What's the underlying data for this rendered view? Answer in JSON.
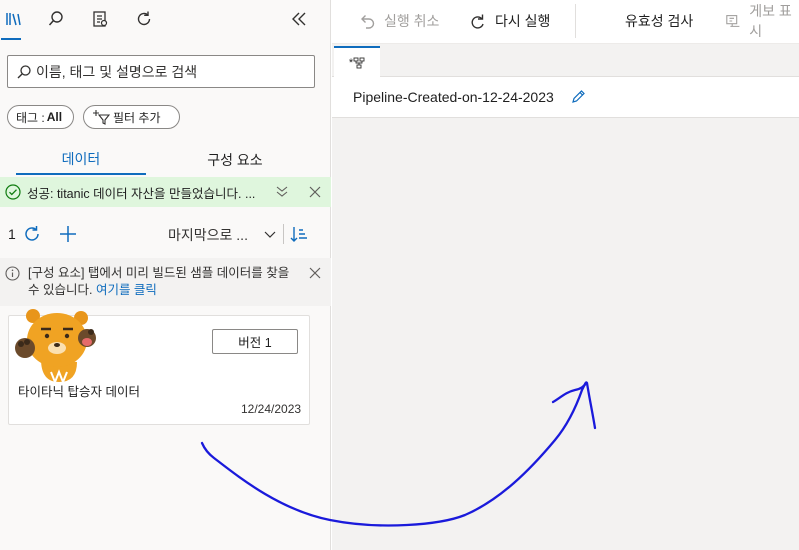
{
  "left_panel": {
    "icons": [
      "library-icon",
      "search-icon",
      "clipboard-icon",
      "refresh-icon",
      "collapse-icon"
    ],
    "search": {
      "placeholder": "이름, 태그 및 설명으로 검색"
    },
    "filters": {
      "tag_label": "태그 :",
      "tag_value": "All",
      "add_filter_label": "필터 추가"
    },
    "tabs": [
      "데이터",
      "구성 요소"
    ],
    "success_banner": {
      "text": "성공: titanic 데이터 자산을 만들었습니다. ..."
    },
    "list_toolbar": {
      "count": "1",
      "sort_label": "마지막으로 ..."
    },
    "info_banner": {
      "text": "[구성 요소] 탭에서 미리 빌드된 샘플 데이터를 찾을 수 있습니다.",
      "link": "여기를 클릭"
    },
    "card": {
      "version_button": "버전 1",
      "name": "타이타닉 탑승자 데이터",
      "date": "12/24/2023"
    }
  },
  "toolbar": {
    "undo": "실행 취소",
    "redo": "다시 실행",
    "validate": "유효성 검사",
    "publish": "게보 표시"
  },
  "doc_tab": {
    "label": "*"
  },
  "pipeline": {
    "title": "Pipeline-Created-on-12-24-2023"
  },
  "colors": {
    "accent": "#0f6cbd",
    "success_bg": "#dff6dd",
    "ink": "#1a1adb"
  }
}
